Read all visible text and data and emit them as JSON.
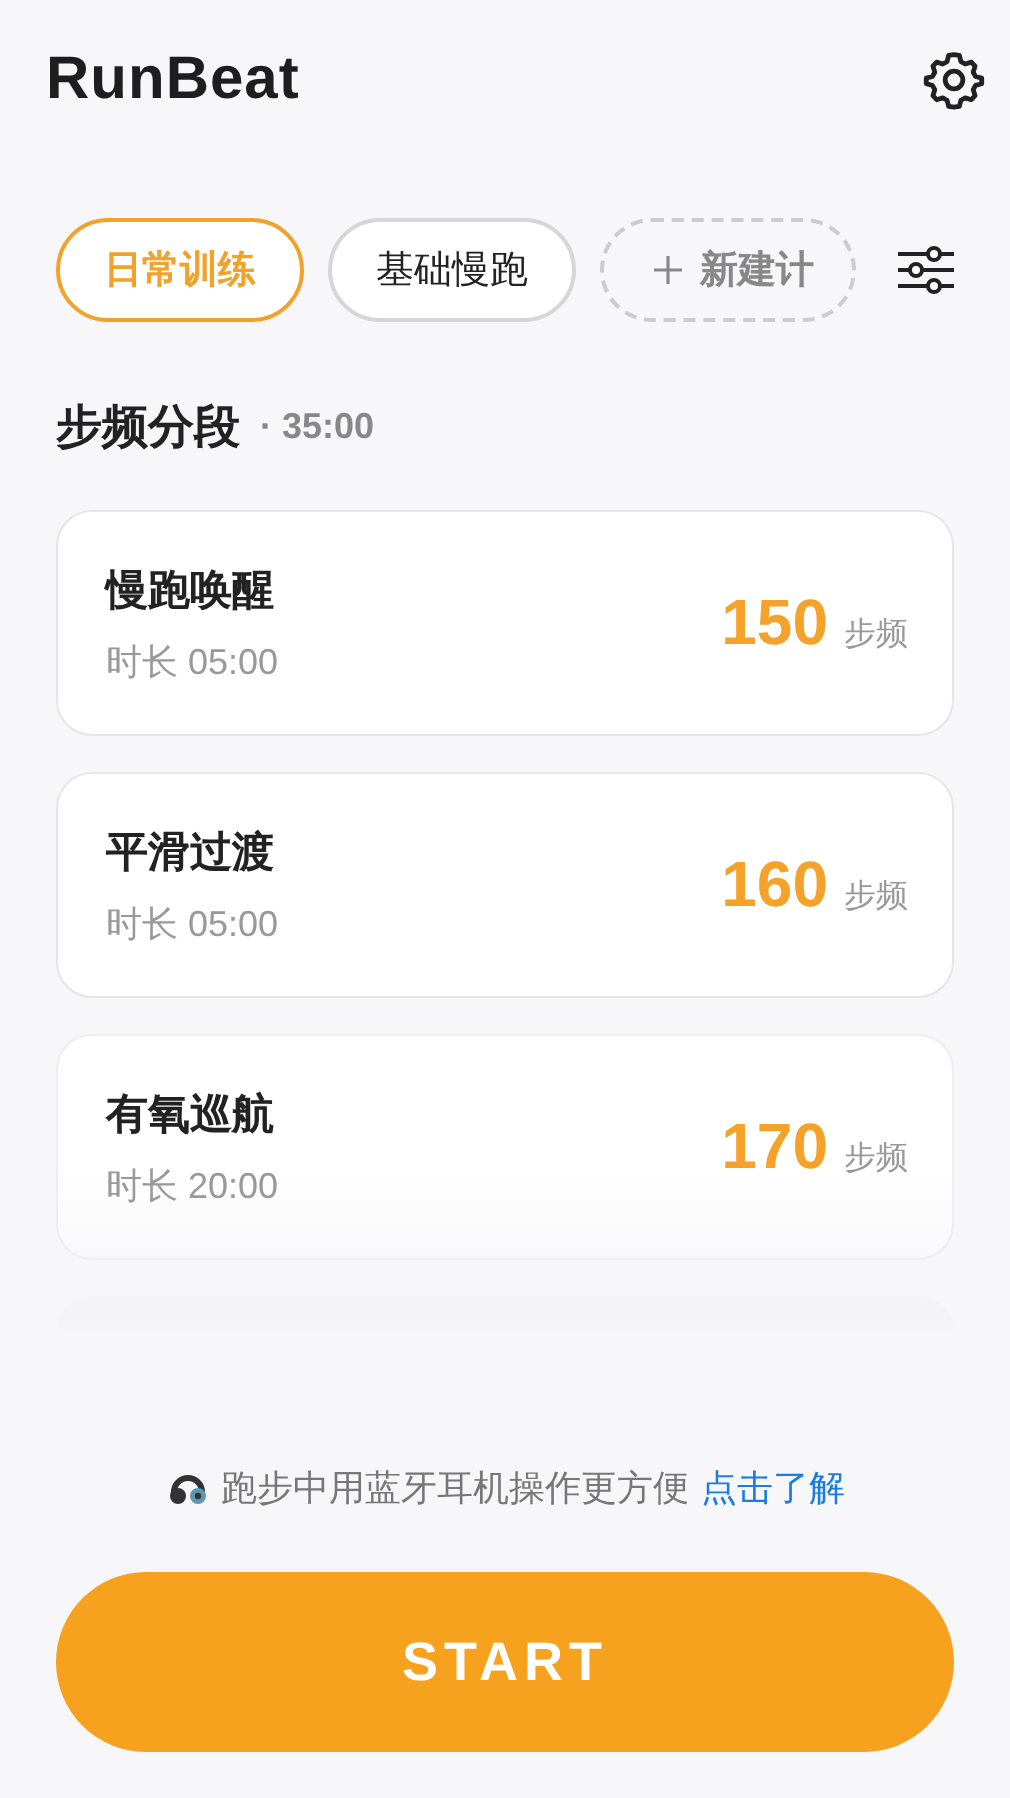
{
  "app_title": "RunBeat",
  "plans": [
    {
      "label": "日常训练",
      "selected": true
    },
    {
      "label": "基础慢跑",
      "selected": false
    }
  ],
  "new_plan": {
    "label": "新建计"
  },
  "section": {
    "title": "步频分段",
    "total": "· 35:00"
  },
  "segments": [
    {
      "name": "慢跑唤醒",
      "duration": "时长 05:00",
      "cadence": "150",
      "unit": "步频"
    },
    {
      "name": "平滑过渡",
      "duration": "时长 05:00",
      "cadence": "160",
      "unit": "步频"
    },
    {
      "name": "有氧巡航",
      "duration": "时长 20:00",
      "cadence": "170",
      "unit": "步频"
    }
  ],
  "hint": {
    "text": "跑步中用蓝牙耳机操作更方便",
    "link": "点击了解"
  },
  "start_button": "START"
}
